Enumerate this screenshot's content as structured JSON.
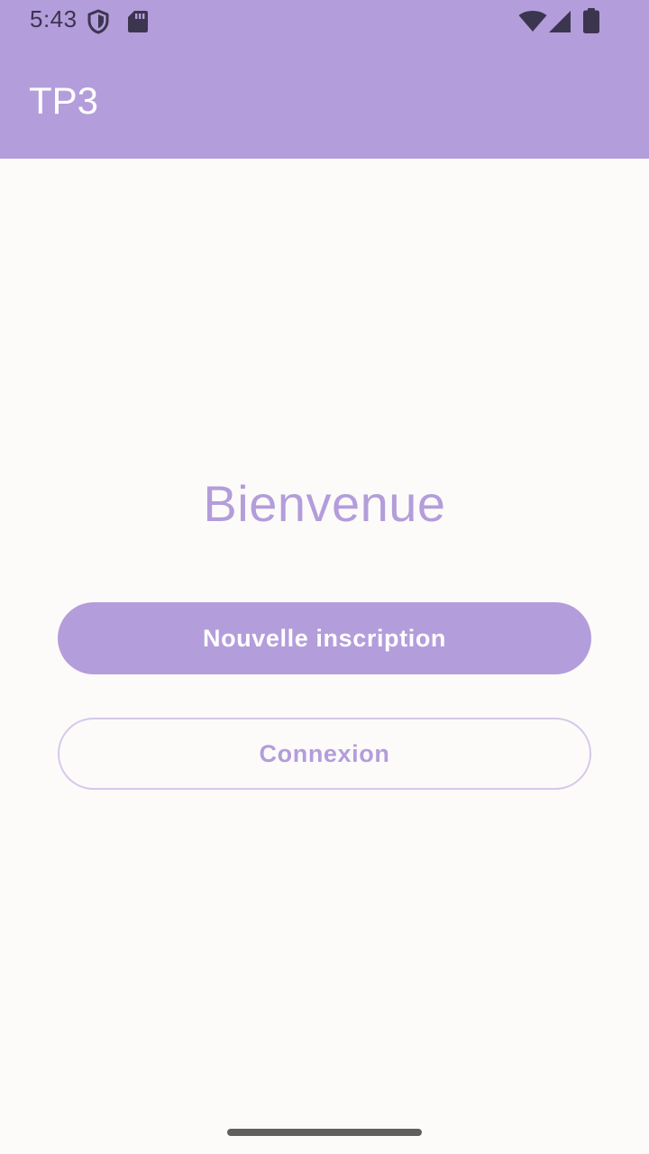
{
  "status_bar": {
    "time": "5:43",
    "icons": [
      "shield-icon",
      "sd-card-icon",
      "wifi-icon",
      "signal-icon",
      "battery-icon"
    ],
    "icon_color": "#3c3550"
  },
  "app_bar": {
    "title": "TP3",
    "background": "#b39ddb"
  },
  "main": {
    "welcome_text": "Bienvenue",
    "primary_button_label": "Nouvelle inscription",
    "secondary_button_label": "Connexion"
  },
  "colors": {
    "accent": "#b39ddb",
    "background": "#fdfbf9",
    "outline": "#d5c8ea"
  }
}
